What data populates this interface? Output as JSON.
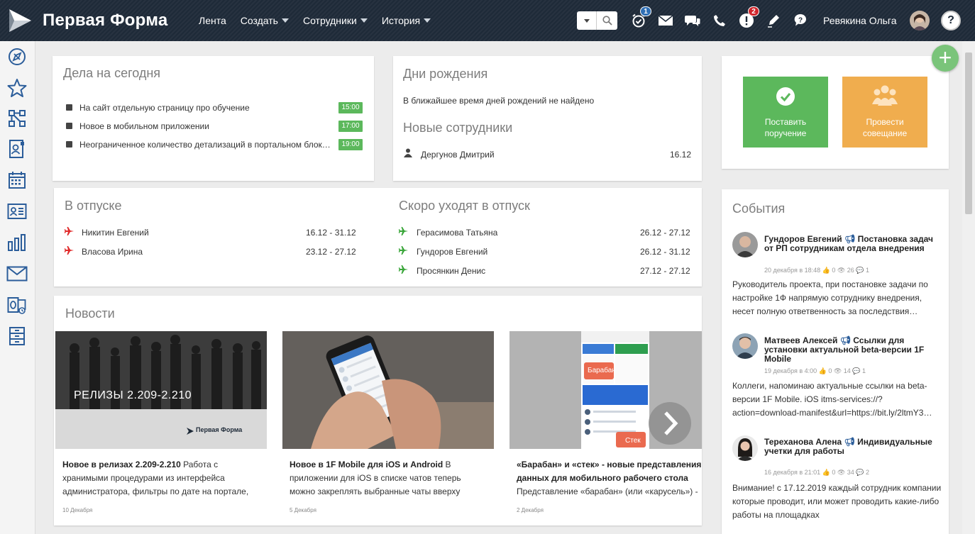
{
  "app": {
    "title": "Первая Форма"
  },
  "nav": {
    "items": [
      {
        "label": "Лента",
        "has_dropdown": false
      },
      {
        "label": "Создать",
        "has_dropdown": true
      },
      {
        "label": "Сотрудники",
        "has_dropdown": true
      },
      {
        "label": "История",
        "has_dropdown": true
      }
    ]
  },
  "toolbar": {
    "icons": [
      "search-icon",
      "alarm-clock-icon",
      "mail-icon",
      "chat-icon",
      "phone-icon",
      "alert-icon",
      "pen-icon",
      "help-bubble-icon"
    ],
    "reminders_badge": "1",
    "alerts_badge": "2",
    "user_name": "Ревякина Ольга",
    "help_label": "?"
  },
  "sidebar": {
    "icons": [
      "compass-icon",
      "star-icon",
      "workflow-icon",
      "contact-card-icon",
      "calendar-icon",
      "id-card-icon",
      "bar-chart-icon",
      "envelope-icon",
      "outlook-icon",
      "archive-icon"
    ]
  },
  "today": {
    "title": "Дела на сегодня",
    "items": [
      {
        "text": "На сайт отдельную страницу про обучение",
        "time": "15:00"
      },
      {
        "text": "Новое в мобильном приложении",
        "time": "17:00"
      },
      {
        "text": "Неограниченное количество детализаций в портальном блок…",
        "time": "19:00"
      }
    ]
  },
  "birthdays": {
    "title": "Дни рождения",
    "empty_text": "В ближайшее время дней рождений не найдено",
    "new_staff_title": "Новые сотрудники",
    "new_staff": [
      {
        "name": "Дергунов Дмитрий",
        "date": "16.12"
      }
    ]
  },
  "vacation": {
    "title": "В отпуске",
    "items": [
      {
        "name": "Никитин Евгений",
        "dates": "16.12 - 31.12"
      },
      {
        "name": "Власова Ирина",
        "dates": "23.12 - 27.12"
      }
    ],
    "upcoming_title": "Скоро уходят в отпуск",
    "upcoming": [
      {
        "name": "Герасимова Татьяна",
        "dates": "26.12 - 27.12"
      },
      {
        "name": "Гундоров Евгений",
        "dates": "26.12 - 31.12"
      },
      {
        "name": "Просянкин Денис",
        "dates": "27.12 - 27.12"
      }
    ]
  },
  "news": {
    "title": "Новости",
    "items": [
      {
        "image_caption": "РЕЛИЗЫ 2.209-2.210",
        "image_logo": "Первая Форма",
        "headline": "Новое в релизах 2.209-2.210",
        "snippet": " Работа с хранимыми процедурами из интерфейса администратора, фильтры по дате на портале,",
        "date": "10 Декабря"
      },
      {
        "headline": "Новое в 1F Mobile для iOS и Android",
        "snippet": " В приложении для iOS в списке чатов теперь можно закреплять выбранные чаты вверху",
        "date": "5 Декабря"
      },
      {
        "image_label_1": "Барабан",
        "image_label_2": "Стек",
        "headline": "«Барабан» и «стек» - новые представления данных для мобильного рабочего стола",
        "snippet": "Представление «барабан» (или «карусель») -",
        "date": "2 Декабря"
      }
    ]
  },
  "actions": {
    "assign": {
      "label": "Поставить поручение",
      "color": "#5cb85c"
    },
    "meeting": {
      "label": "Провести совещание",
      "color": "#f0ad4e"
    }
  },
  "events": {
    "title": "События",
    "items": [
      {
        "author": "Гундоров Евгений",
        "topic": "Постановка задач от РП сотрудникам отдела внедрения",
        "meta": "20 декабря в 18:48 👍 0 👁 26 💬 1",
        "body": "Руководитель проекта, при постановке задачи по настройке 1Ф напрямую сотруднику внедрения, несет полную ответвенность за последствия…"
      },
      {
        "author": "Матвеев Алексей",
        "topic": "Ссылки для установки актуальной beta-версии 1F Mobile",
        "meta": "19 декабря в 4:00 👍 0 👁 14 💬 1",
        "body": "Коллеги, напоминаю актуальные ссылки на beta-версии 1F Mobile. iOS itms-services://?action=download-manifest&url=https://bit.ly/2ltmY3…"
      },
      {
        "author": "Тереханова Алена",
        "topic": "Индивидуальные учетки для работы",
        "meta": "16 декабря в 21:01 👍 0 👁 34 💬 2",
        "body": "Внимание! с 17.12.2019 каждый сотрудник компании которые проводит, или может проводить какие-либо работы на площадках"
      }
    ]
  },
  "fab": {
    "label": "+"
  }
}
